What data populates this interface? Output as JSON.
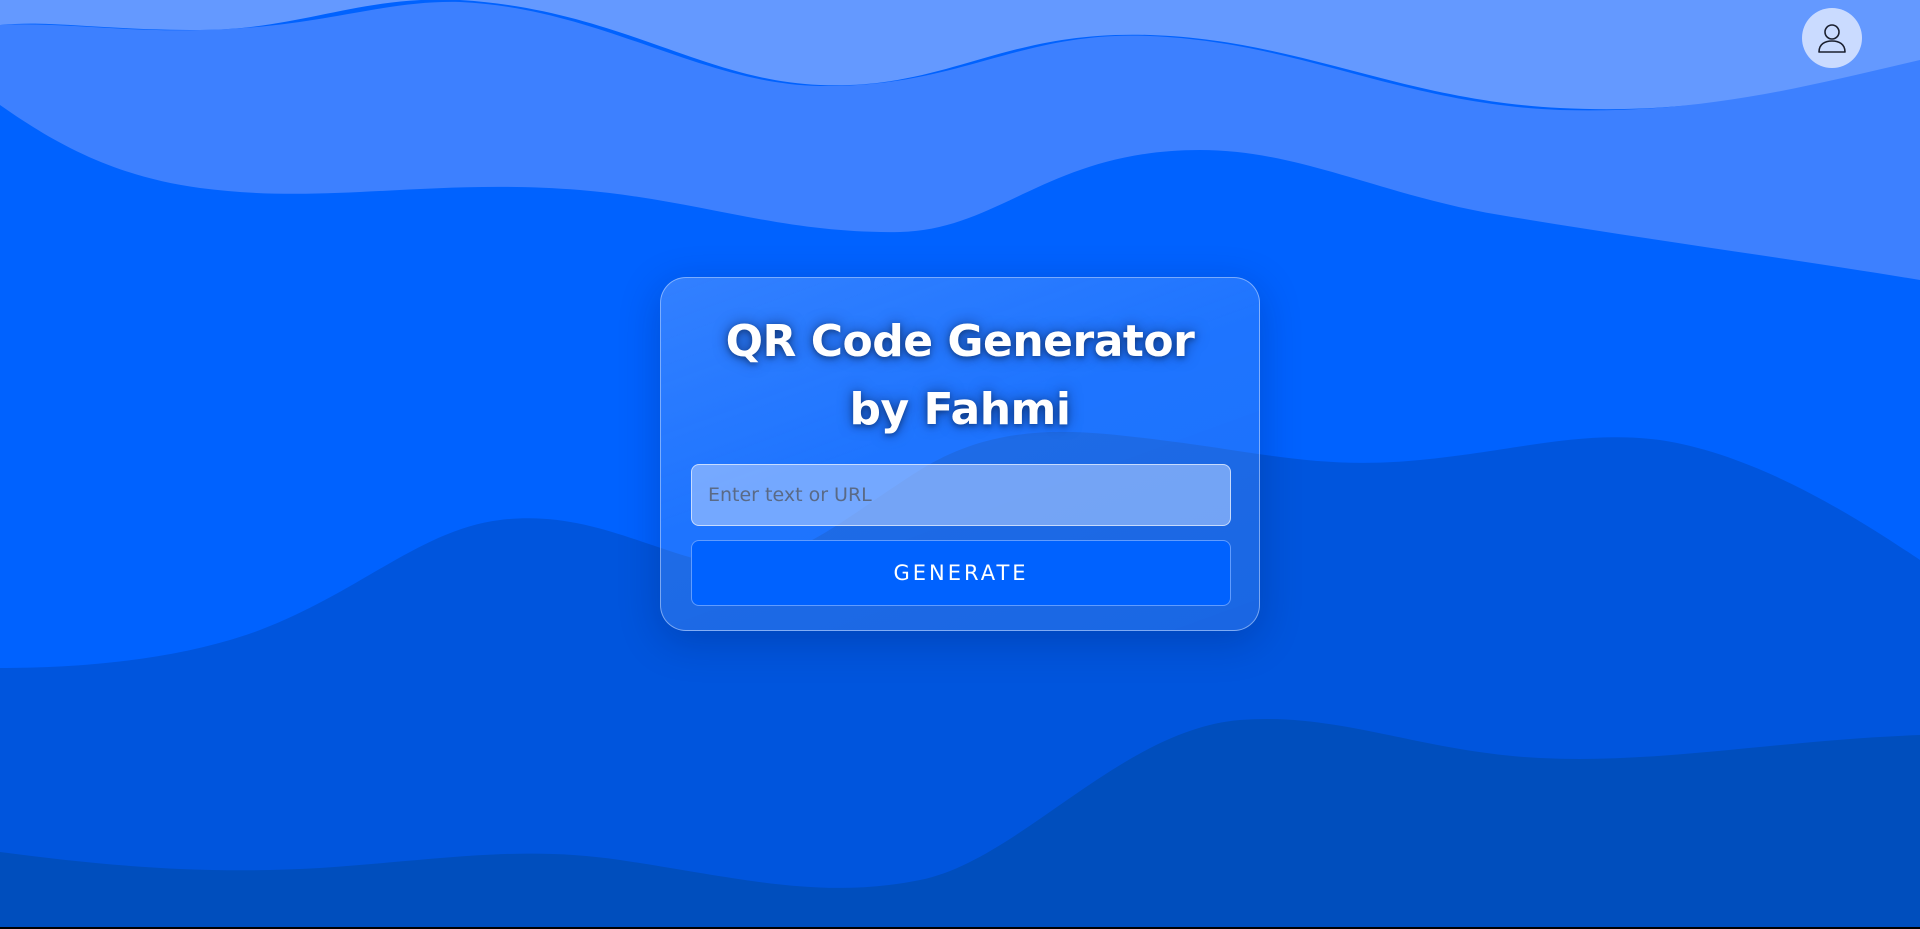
{
  "app": {
    "title": "QR Code Generator by Fahmi"
  },
  "header": {
    "profile_icon": "user-icon"
  },
  "form": {
    "input_value": "",
    "input_placeholder": "Enter text or URL",
    "generate_label": "GENERATE"
  },
  "theme": {
    "background": "#0062ff",
    "button": "#0062ff",
    "wave_light": "#6499ff",
    "wave_mid": "#3d80ff",
    "wave_dark": "#0055dd",
    "wave_darkest": "#004ebd"
  }
}
